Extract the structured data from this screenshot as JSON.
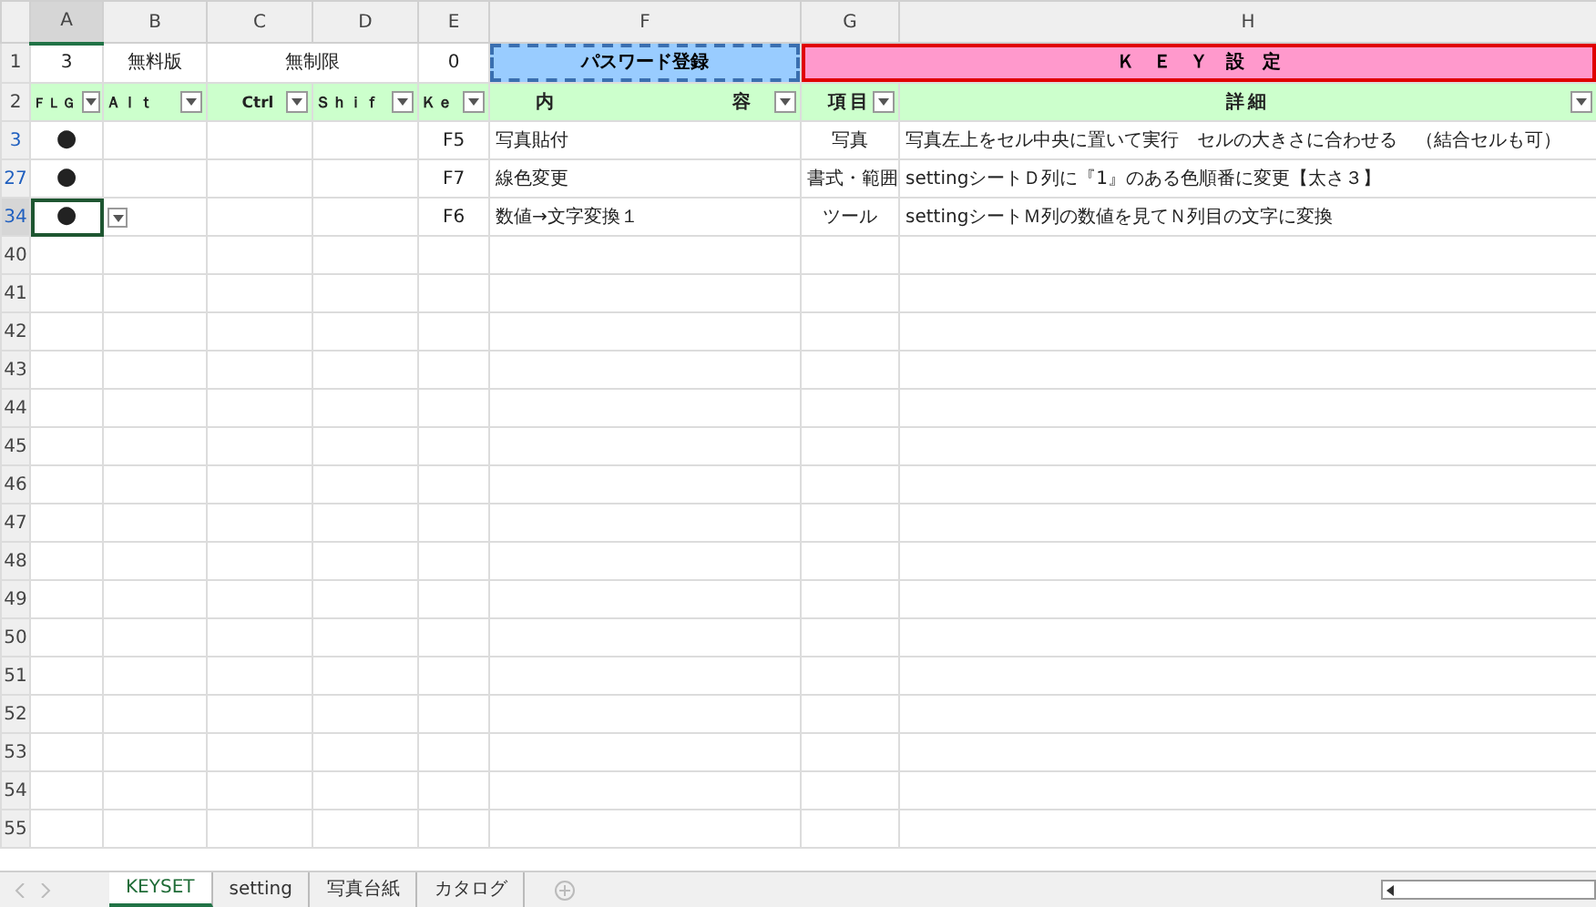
{
  "columns": [
    {
      "label": "A",
      "selected": true
    },
    {
      "label": "B",
      "selected": false
    },
    {
      "label": "C",
      "selected": false
    },
    {
      "label": "D",
      "selected": false
    },
    {
      "label": "E",
      "selected": false
    },
    {
      "label": "F",
      "selected": false
    },
    {
      "label": "G",
      "selected": false
    },
    {
      "label": "H",
      "selected": false
    }
  ],
  "row1": {
    "number": "1",
    "count": "3",
    "edition": "無料版",
    "limit": "無制限",
    "zero": "0",
    "password_button": "パスワード登録",
    "title": "Ｋ　Ｅ　Ｙ　設　定"
  },
  "row2": {
    "number": "2",
    "headers": [
      "ＦＬＧ",
      "Ａｌｔ",
      "Ctrl",
      "Ｓｈｉｆ",
      "Ｋｅ",
      "内　　　　　　　　容",
      "項目",
      "詳細"
    ]
  },
  "rows": [
    {
      "number": "3",
      "filtered": true,
      "selected": false,
      "flg": "●",
      "key": "F5",
      "content": "写真貼付",
      "category": "写真",
      "detail": "写真左上をセル中央に置いて実行　セルの大きさに合わせる　（結合セルも可）"
    },
    {
      "number": "27",
      "filtered": true,
      "selected": false,
      "flg": "●",
      "key": "F7",
      "content": "線色変更",
      "category": "書式・範囲",
      "detail": "settingシートＤ列に『1』のある色順番に変更【太さ３】"
    },
    {
      "number": "34",
      "filtered": true,
      "selected": true,
      "flg": "●",
      "key": "F6",
      "content": "数値→文字変換１",
      "category": "ツール",
      "detail": "settingシートＭ列の数値を見てＮ列目の文字に変換"
    }
  ],
  "empty_rows": [
    "40",
    "41",
    "42",
    "43",
    "44",
    "45",
    "46",
    "47",
    "48",
    "49",
    "50",
    "51",
    "52",
    "53",
    "54",
    "55"
  ],
  "sheet_tabs": [
    {
      "label": "KEYSET",
      "selected": true
    },
    {
      "label": "setting",
      "selected": false
    },
    {
      "label": "写真台紙",
      "selected": false
    },
    {
      "label": "カタログ",
      "selected": false
    }
  ]
}
